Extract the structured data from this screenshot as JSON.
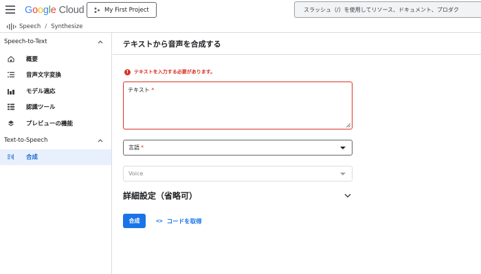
{
  "topbar": {
    "logo_google_letters": [
      "G",
      "o",
      "o",
      "g",
      "l",
      "e"
    ],
    "logo_cloud": "Cloud",
    "project_label": "My First Project",
    "search_placeholder": "スラッシュ（/）を使用してリソース、ドキュメント、プロダク"
  },
  "breadcrumb": {
    "items": [
      "Speech",
      "Synthesize"
    ],
    "separator": "/"
  },
  "sidebar": {
    "sections": [
      {
        "title": "Speech-to-Text",
        "items": [
          {
            "label": "概要",
            "icon": "home-icon"
          },
          {
            "label": "音声文字変換",
            "icon": "list-icon"
          },
          {
            "label": "モデル適応",
            "icon": "chart-icon"
          },
          {
            "label": "認識ツール",
            "icon": "grid-list-icon"
          },
          {
            "label": "プレビューの機能",
            "icon": "layers-icon"
          }
        ]
      },
      {
        "title": "Text-to-Speech",
        "items": [
          {
            "label": "合成",
            "icon": "synthesize-icon",
            "active": true
          }
        ]
      }
    ]
  },
  "main": {
    "title": "テキストから音声を合成する",
    "error": "テキストを入力する必要があります。",
    "text_label": "テキスト",
    "required_mark": "*",
    "language_label": "言語",
    "voice_label": "Voice",
    "advanced_label": "詳細設定（省略可）",
    "synthesize_button": "合成",
    "code_link_icon": "<>",
    "code_link": "コードを取得"
  },
  "colors": {
    "accent": "#1a73e8",
    "error": "#d93025",
    "active_bg": "#e8f0fe"
  }
}
